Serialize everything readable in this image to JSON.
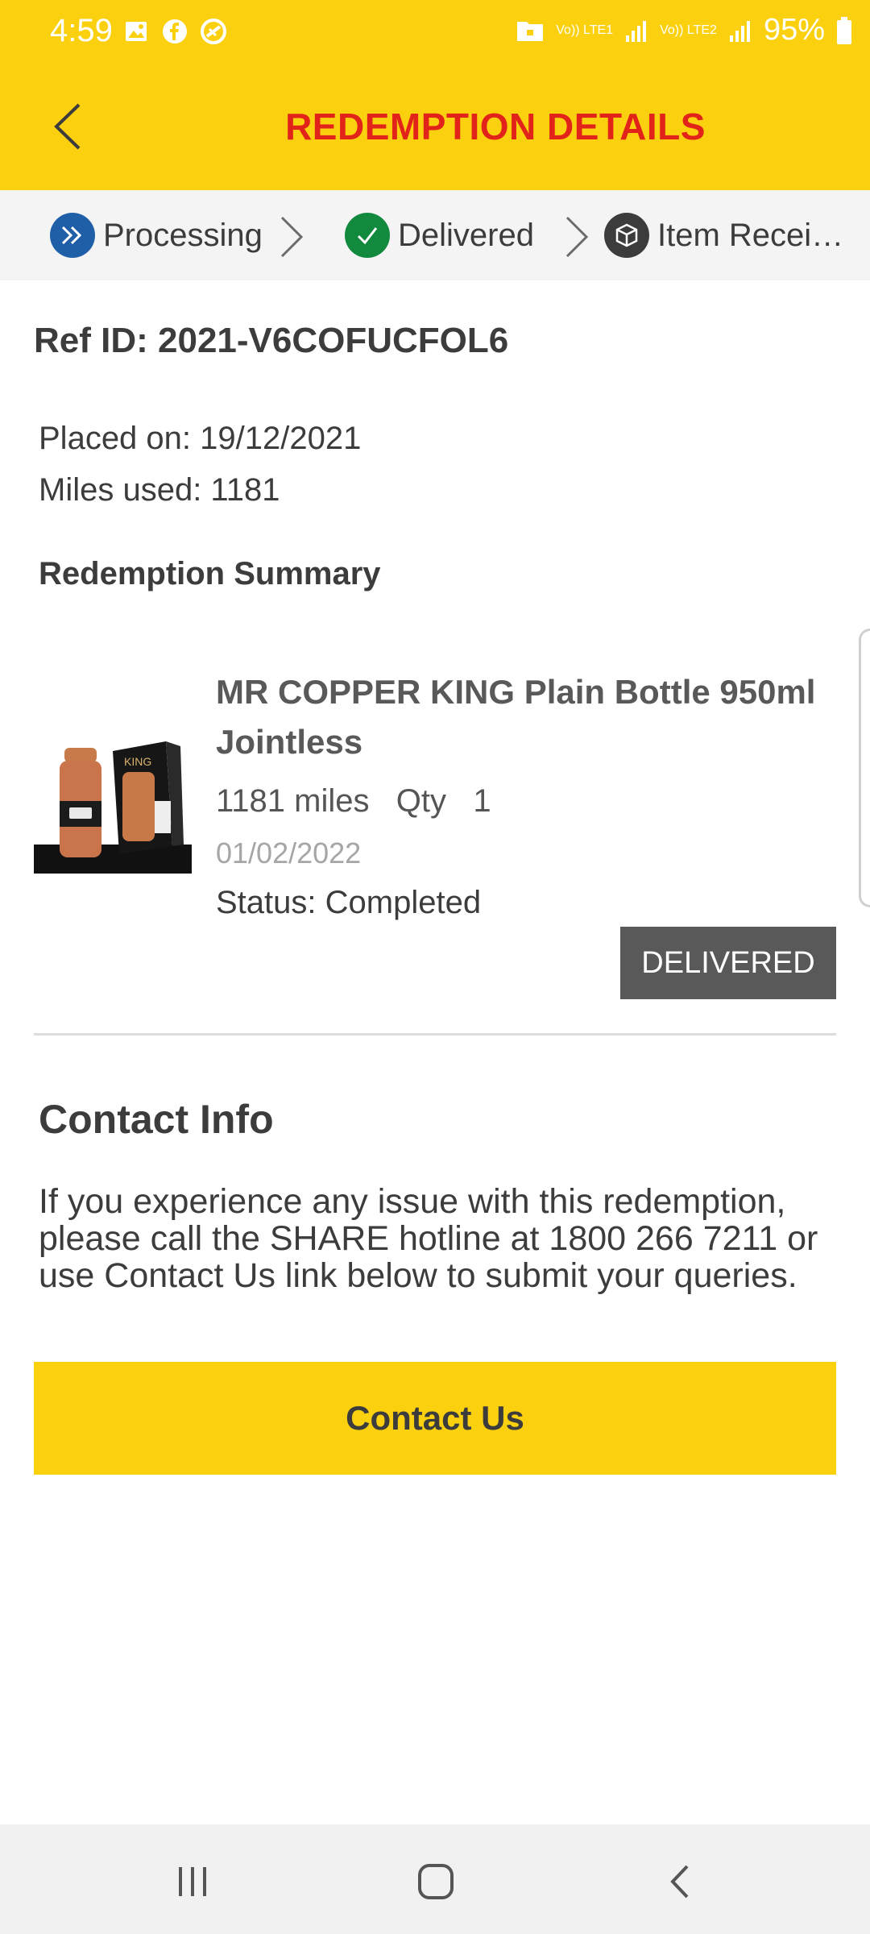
{
  "status_bar": {
    "time": "4:59",
    "icons": [
      "image-icon",
      "facebook-icon",
      "vpn-icon"
    ],
    "network1": "Vo)) LTE1",
    "network2": "Vo)) LTE2",
    "battery": "95%"
  },
  "header": {
    "title": "REDEMPTION DETAILS",
    "accent": "#fbd00f",
    "title_color": "#e2231a"
  },
  "steps": [
    {
      "label": "Processing",
      "icon": "double-chevron-icon",
      "color": "#1f5fa8"
    },
    {
      "label": "Delivered",
      "icon": "check-icon",
      "color": "#118a3e"
    },
    {
      "label": "Item Recei…",
      "icon": "box-icon",
      "color": "#3c3c3c"
    }
  ],
  "details": {
    "ref_id": "Ref ID: 2021-V6COFUCFOL6",
    "placed_on": "Placed on: 19/12/2021",
    "miles_used": "Miles used: 1181",
    "summary_title": "Redemption Summary"
  },
  "product": {
    "name": "MR COPPER KING Plain Bottle 950ml Jointless",
    "miles_qty": "1181 miles   Qty   1",
    "date": "01/02/2022",
    "status": "Status: Completed",
    "badge": "DELIVERED"
  },
  "contact": {
    "title": "Contact Info",
    "text": "If you experience any issue with this redemption, please call the SHARE hotline at 1800 266 7211 or use Contact Us link below to submit your queries.",
    "button": "Contact Us"
  }
}
